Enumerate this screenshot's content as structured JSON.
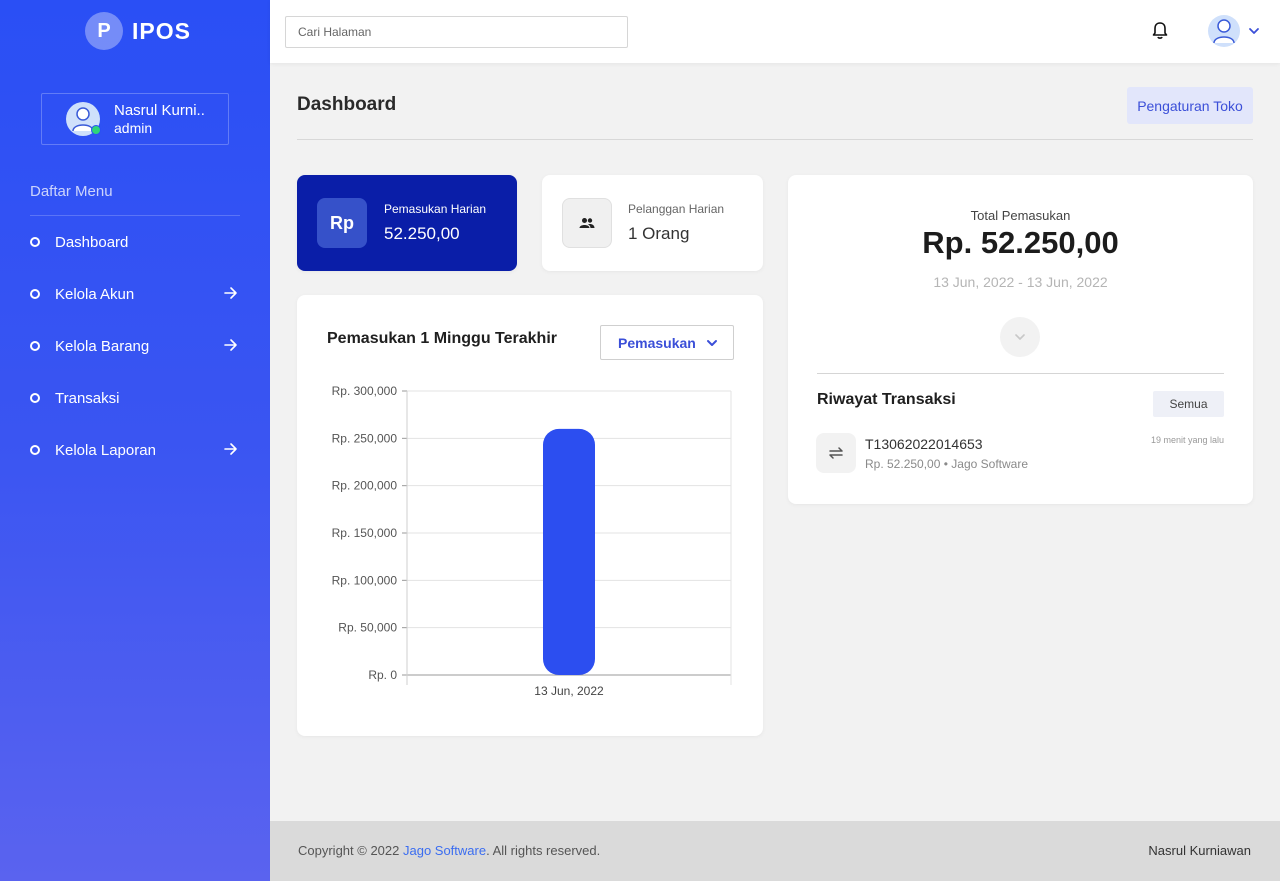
{
  "app": {
    "logo_letter": "P",
    "name": "IPOS"
  },
  "user": {
    "name": "Nasrul Kurni..",
    "role": "admin"
  },
  "sidebar": {
    "menu_title": "Daftar Menu",
    "items": [
      {
        "label": "Dashboard",
        "has_arrow": false
      },
      {
        "label": "Kelola Akun",
        "has_arrow": true
      },
      {
        "label": "Kelola Barang",
        "has_arrow": true
      },
      {
        "label": "Transaksi",
        "has_arrow": false
      },
      {
        "label": "Kelola Laporan",
        "has_arrow": true
      }
    ]
  },
  "topbar": {
    "search_placeholder": "Cari Halaman"
  },
  "page": {
    "title": "Dashboard",
    "settings_button": "Pengaturan Toko"
  },
  "stats": {
    "income_icon": "Rp",
    "income_label": "Pemasukan Harian",
    "income_value": "52.250,00",
    "customer_label": "Pelanggan Harian",
    "customer_value": "1 Orang"
  },
  "chart_card": {
    "title": "Pemasukan 1 Minggu Terakhir",
    "select_value": "Pemasukan"
  },
  "chart_data": {
    "type": "bar",
    "categories": [
      "13 Jun, 2022"
    ],
    "values": [
      260000
    ],
    "ylim": [
      0,
      300000
    ],
    "yticks": [
      0,
      50000,
      100000,
      150000,
      200000,
      250000,
      300000
    ],
    "ytick_labels": [
      "Rp. 0",
      "Rp. 50,000",
      "Rp. 100,000",
      "Rp. 150,000",
      "Rp. 200,000",
      "Rp. 250,000",
      "Rp. 300,000"
    ],
    "grid": true,
    "bar_color": "#2c4ef0"
  },
  "summary": {
    "label": "Total Pemasukan",
    "value": "Rp. 52.250,00",
    "range": "13 Jun, 2022 - 13 Jun, 2022"
  },
  "history": {
    "title": "Riwayat Transaksi",
    "all_button": "Semua",
    "items": [
      {
        "id": "T13062022014653",
        "amount": "Rp. 52.250,00",
        "store": "Jago Software",
        "time": "19 menit yang lalu"
      }
    ]
  },
  "footer": {
    "prefix": "Copyright © 2022 ",
    "link": "Jago Software",
    "suffix": ". All rights reserved.",
    "right": "Nasrul Kurniawan"
  },
  "colors": {
    "sidebar": "#2a4ff5",
    "income_card": "#0a1ea8",
    "accent": "#3b4fd8"
  }
}
